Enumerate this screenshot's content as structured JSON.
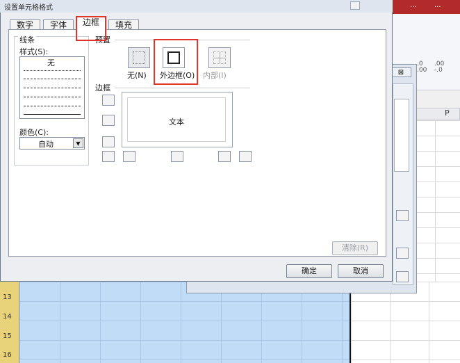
{
  "background": {
    "top_right": [
      "...",
      "..."
    ],
    "ribbon_labels": [
      ".00\n-.0",
      ".0\n.00"
    ],
    "column_header": "P",
    "row_numbers": [
      "13",
      "14",
      "15",
      "16"
    ]
  },
  "back_dialog": {
    "close_glyph": "⊠"
  },
  "dialog": {
    "title": "设置单元格格式",
    "tabs": [
      "数字",
      "字体",
      "边框",
      "填充"
    ],
    "active_tab": "边框",
    "line_group": {
      "title": "线条",
      "style_label": "样式(S):",
      "style_none": "无",
      "color_label": "颜色(C):",
      "color_value": "自动",
      "color_arrow": "▼"
    },
    "presets": {
      "title": "预置",
      "none": "无(N)",
      "outline": "外边框(O)",
      "inside": "内部(I)"
    },
    "border": {
      "title": "边框",
      "preview_text": "文本"
    },
    "clear_button": "清除(R)",
    "ok_button": "确定",
    "cancel_button": "取消"
  }
}
